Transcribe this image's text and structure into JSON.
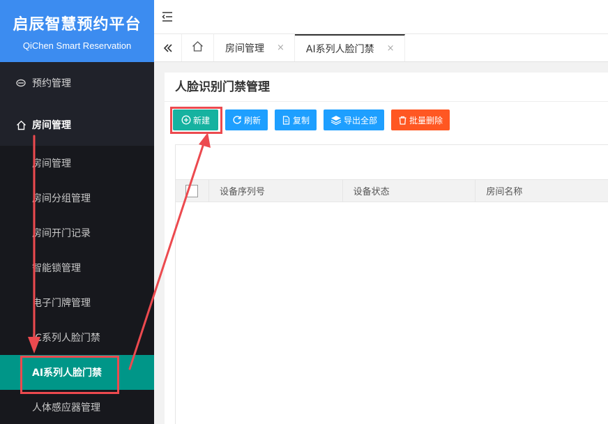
{
  "brand": {
    "title": "启辰智慧预约平台",
    "subtitle": "QiChen Smart Reservation"
  },
  "sidebar": {
    "items": [
      {
        "label": "预约管理",
        "icon": "link-icon"
      },
      {
        "label": "房间管理",
        "icon": "home-icon"
      }
    ],
    "submenu": [
      {
        "label": "房间管理"
      },
      {
        "label": "房间分组管理"
      },
      {
        "label": "房间开门记录"
      },
      {
        "label": "智能锁管理"
      },
      {
        "label": "电子门牌管理"
      },
      {
        "label": "IC系列人脸门禁"
      },
      {
        "label": "AI系列人脸门禁"
      },
      {
        "label": "人体感应器管理"
      }
    ]
  },
  "tabs": {
    "items": [
      {
        "label": "房间管理",
        "close": "×"
      },
      {
        "label": "AI系列人脸门禁",
        "close": "×"
      }
    ]
  },
  "page": {
    "title": "人脸识别门禁管理"
  },
  "toolbar": {
    "new_label": "新建",
    "refresh_label": "刷新",
    "copy_label": "复制",
    "export_label": "导出全部",
    "delete_label": "批量删除"
  },
  "table": {
    "columns": [
      "设备序列号",
      "设备状态",
      "房间名称"
    ]
  },
  "colors": {
    "brand": "#3c8cf0",
    "sidebar": "#20222a",
    "active": "#009688",
    "primary": "#1e9fff",
    "danger": "#ff5722",
    "annotation": "#ec4a4f"
  }
}
